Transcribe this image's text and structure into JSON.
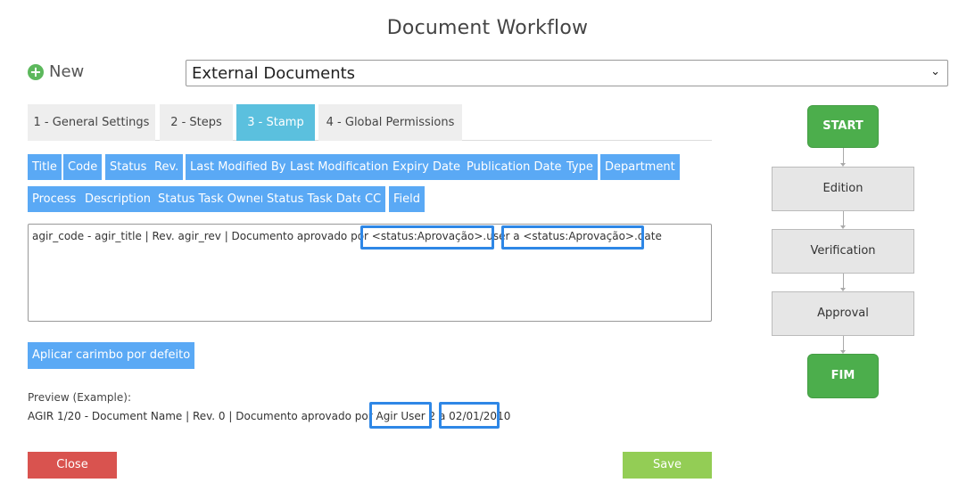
{
  "page": {
    "title": "Document Workflow"
  },
  "new_button": {
    "label": "New",
    "icon": "plus-circle-icon"
  },
  "document_type": {
    "selected": "External Documents"
  },
  "tabs": [
    {
      "label": "1 - General Settings",
      "active": false
    },
    {
      "label": "2 - Steps",
      "active": false
    },
    {
      "label": "3 - Stamp",
      "active": true
    },
    {
      "label": "4 - Global Permissions",
      "active": false
    }
  ],
  "field_chips": [
    "Title",
    "Code",
    "Status",
    "Rev.",
    "Last Modified By",
    "Last Modification",
    "Expiry Date",
    "Publication Date",
    "Type",
    "Department",
    "Process",
    "Description",
    "Status Task Owner",
    "Status Task Date",
    "CC",
    "Field"
  ],
  "stamp": {
    "text": "agir_code - agir_title | Rev. agir_rev | Documento aprovado por <status:Aprovação>.user a <status:Aprovação>.date"
  },
  "apply_default_label": "Aplicar carimbo por defeito",
  "preview": {
    "label": "Preview (Example):",
    "text": "AGIR 1/20 - Document Name | Rev. 0 | Documento aprovado por Agir User 2 a 02/01/2010"
  },
  "buttons": {
    "close": "Close",
    "save": "Save"
  },
  "workflow": {
    "start": "START",
    "steps": [
      "Edition",
      "Verification",
      "Approval"
    ],
    "end": "FIM"
  },
  "colors": {
    "tab_active": "#5bc0de",
    "chip": "#5aa9f5",
    "highlight": "#2e87e6",
    "close": "#d9534f",
    "save": "#93cd55",
    "terminal": "#4cae4c"
  }
}
